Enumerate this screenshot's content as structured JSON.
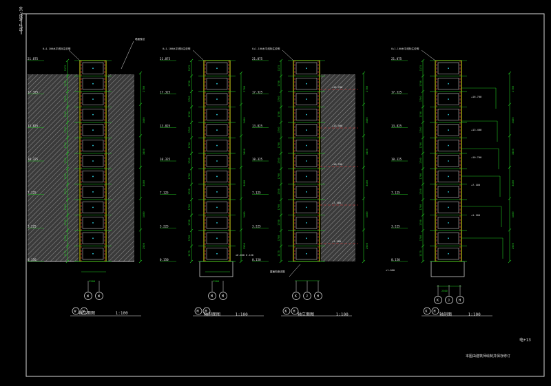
{
  "sheet": {
    "side_label": "SLT-ASD:30",
    "page_mark": "电+13",
    "footer_note": "本图由建筑师绘制并保存修订"
  },
  "panels": [
    {
      "id": "p1",
      "title_axes": [
        "W",
        "W"
      ],
      "title_text": "轴立面图",
      "scale": "1:100",
      "dim_bottom": "2500",
      "top_note": "0+1.100水平线标注说明",
      "side_note": "墙面做法",
      "axis_labels": [
        "W",
        "W"
      ]
    },
    {
      "id": "p2",
      "title_axes": [
        "M",
        "M"
      ],
      "title_text": "轴剖面图",
      "scale": "1:100",
      "dim_bottom": "2500",
      "top_note": "0+1.100水平线标注说明",
      "side_note": "±0.000 0.150",
      "axis_labels": [
        "M",
        "M"
      ]
    },
    {
      "id": "p3",
      "title_axes": [
        "K",
        "H"
      ],
      "title_text": "轴立面图",
      "scale": "1:100",
      "dim_bottom": "2500",
      "top_note": "0+1.100水平线标注说明",
      "side_note": "屋面构造详图",
      "axis_labels": [
        "K",
        "J",
        "H"
      ]
    },
    {
      "id": "p4",
      "title_axes": [
        "K",
        "H"
      ],
      "title_text": "轴剖面",
      "scale": "1:100",
      "dim_bottom": "2500",
      "top_note": "0+1.100水平线标注说明",
      "side_note": "±1.000",
      "axis_labels": [
        "K",
        "J",
        "H"
      ]
    }
  ],
  "elevations": [
    "21.875",
    "17.325",
    "13.825",
    "10.325",
    "7.125",
    "3.225",
    "0.150"
  ],
  "floor_dims": [
    "1175",
    "1700",
    "1700",
    "1700",
    "1700",
    "1700",
    "1700",
    "1700",
    "1700",
    "1700",
    "1700",
    "1700",
    "1175"
  ],
  "right_dims": [
    "2700",
    "3400",
    "3400",
    "3400",
    "3400",
    "2500"
  ],
  "labels_mid": [
    "+1.100",
    "+7.100",
    "+10.700",
    "+13.400",
    "+16.700"
  ],
  "colors": {
    "green": "#21c821",
    "yellow": "#e6e619",
    "red": "#e03030",
    "cyan": "#30d0e0",
    "white": "#e8e8e8",
    "hatch": "#6a6a6a"
  }
}
